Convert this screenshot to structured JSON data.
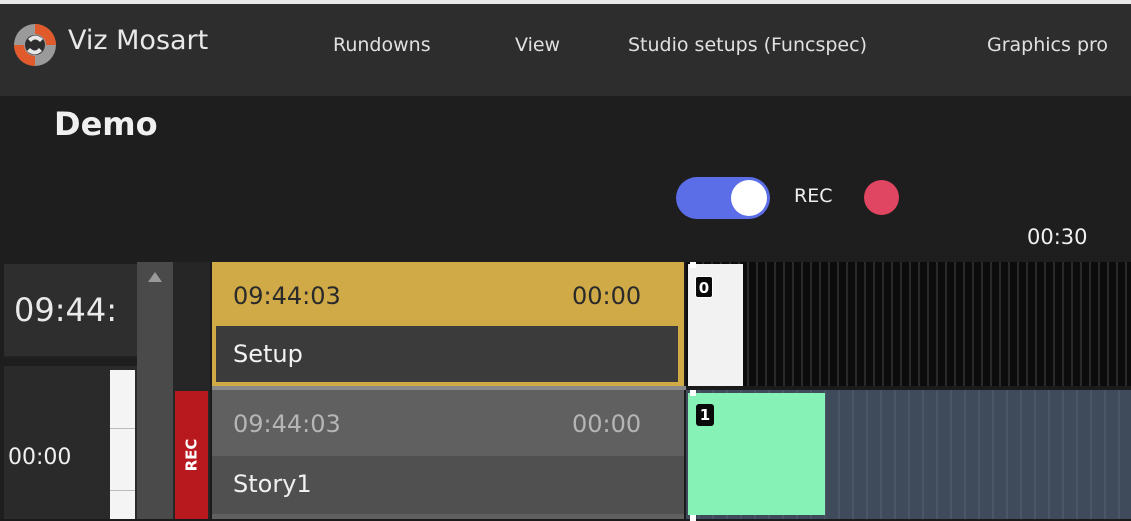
{
  "app": {
    "name": "Viz Mosart",
    "logo_icon": "viz-mosart-logo",
    "brand_colors": {
      "orange": "#e05a2b",
      "grey": "#9a9a9a"
    }
  },
  "menu": {
    "items": [
      "Rundowns",
      "View",
      "Studio setups (Funcspec)",
      "Graphics pro"
    ]
  },
  "rundown": {
    "title": "Demo",
    "recording_toggle_on": true,
    "rec_label": "REC",
    "rec_indicator_color": "#e04561",
    "toggle_color": "#5b6ee8",
    "timeline_tick": "00:30"
  },
  "left": {
    "clock": "09:44:",
    "duration": "00:00"
  },
  "stories": [
    {
      "time": "09:44:03",
      "duration": "00:00",
      "name": "Setup",
      "status": "current",
      "color": "#cfaa47",
      "item_index": "0"
    },
    {
      "time": "09:44:03",
      "duration": "00:00",
      "name": "Story1",
      "status": "next",
      "tag": "REC",
      "color": "#606060",
      "item_index": "1"
    }
  ]
}
